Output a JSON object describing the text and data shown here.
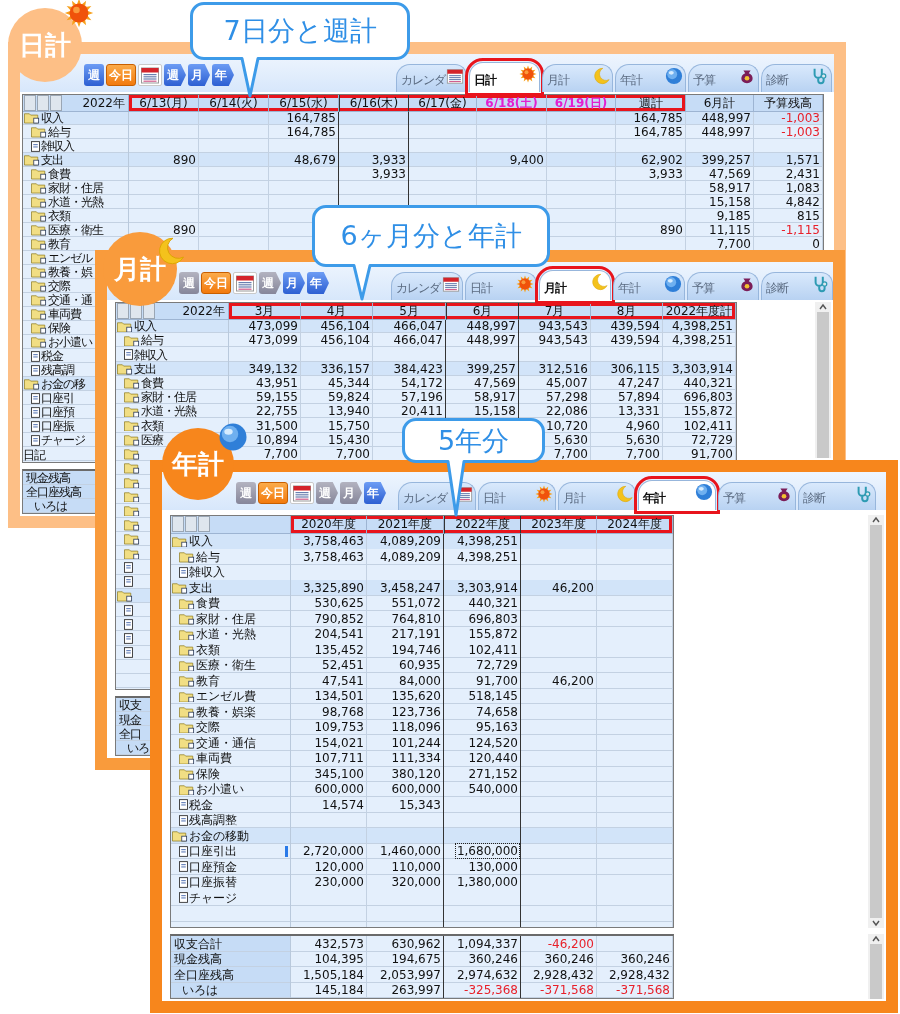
{
  "panels": [
    {
      "kind": "day",
      "badge": "日計",
      "color": "#fdbf86",
      "callout": "7日分と週計",
      "nav": [
        {
          "kind": "prev",
          "label": "週",
          "active": true
        },
        {
          "kind": "today",
          "label": "今日"
        },
        {
          "kind": "calendar"
        },
        {
          "kind": "next",
          "label": "週",
          "active": true
        },
        {
          "kind": "next",
          "label": "月",
          "active": true
        },
        {
          "kind": "next",
          "label": "年",
          "active": true
        }
      ],
      "tabs": [
        {
          "label": "カレンダ",
          "selected": false,
          "highlighted": false
        },
        {
          "label": "日計",
          "selected": true,
          "highlighted": true
        },
        {
          "label": "月計",
          "selected": false,
          "highlighted": false
        },
        {
          "label": "年計",
          "selected": false,
          "highlighted": false
        },
        {
          "label": "予算",
          "selected": false,
          "highlighted": false
        },
        {
          "label": "診断",
          "selected": false,
          "highlighted": false
        }
      ],
      "table": {
        "year_label": "2022年",
        "columns": [
          {
            "label": "6/13(月)",
            "weekend": false,
            "current": false,
            "highlighted": true
          },
          {
            "label": "6/14(火)",
            "weekend": false,
            "current": false,
            "highlighted": true
          },
          {
            "label": "6/15(水)",
            "weekend": false,
            "current": false,
            "highlighted": true
          },
          {
            "label": "6/16(木)",
            "weekend": false,
            "current": true,
            "highlighted": true
          },
          {
            "label": "6/17(金)",
            "weekend": false,
            "current": false,
            "highlighted": true
          },
          {
            "label": "6/18(土)",
            "weekend": true,
            "current": false,
            "highlighted": true
          },
          {
            "label": "6/19(日)",
            "weekend": true,
            "current": false,
            "highlighted": true
          },
          {
            "label": "週計",
            "weekend": false,
            "current": false,
            "highlighted": true
          },
          {
            "label": "6月計",
            "weekend": false,
            "current": false,
            "highlighted": false
          },
          {
            "label": "予算残高",
            "weekend": false,
            "current": false,
            "highlighted": false
          }
        ],
        "rows": [
          {
            "label": "収入",
            "kind": "folder",
            "values": {
              "col_3": "164,785",
              "col_8": "164,785",
              "col_9": "448,997",
              "col_10": {
                "value": "-1,003",
                "negative": true
              }
            },
            "children": [
              {
                "label": "給与",
                "kind": "folder",
                "values": {
                  "col_3": "164,785",
                  "col_8": "164,785",
                  "col_9": "448,997",
                  "col_10": {
                    "value": "-1,003",
                    "negative": true
                  }
                }
              },
              {
                "label": "雑収入",
                "kind": "document"
              }
            ]
          },
          {
            "label": "支出",
            "kind": "folder",
            "values": {
              "col_1": "890",
              "col_3": "48,679",
              "col_4": "3,933",
              "col_6": "9,400",
              "col_8": "62,902",
              "col_9": "399,257",
              "col_10": "1,571"
            },
            "children": [
              {
                "label": "食費",
                "kind": "folder",
                "values": {
                  "col_4": "3,933",
                  "col_8": "3,933",
                  "col_9": "47,569",
                  "col_10": "2,431"
                }
              },
              {
                "label": "家財・住居",
                "kind": "folder",
                "values": {
                  "col_9": "58,917",
                  "col_10": "1,083"
                }
              },
              {
                "label": "水道・光熱",
                "kind": "folder",
                "values": {
                  "col_9": "15,158",
                  "col_10": "4,842"
                }
              },
              {
                "label": "衣類",
                "kind": "folder",
                "values": {
                  "col_9": "9,185",
                  "col_10": "815"
                }
              },
              {
                "label": "医療・衛生",
                "kind": "folder",
                "values": {
                  "col_1": "890",
                  "col_8": "890",
                  "col_9": "11,115",
                  "col_10": {
                    "value": "-1,115",
                    "negative": true
                  }
                }
              },
              {
                "label": "教育",
                "kind": "folder",
                "values": {
                  "col_9": "7,700",
                  "col_10": "0"
                }
              },
              {
                "label": "エンゼル",
                "kind": "folder"
              },
              {
                "label": "教養・娯",
                "kind": "folder"
              },
              {
                "label": "交際",
                "kind": "folder"
              },
              {
                "label": "交通・通",
                "kind": "folder"
              },
              {
                "label": "車両費",
                "kind": "folder"
              },
              {
                "label": "保険",
                "kind": "folder"
              },
              {
                "label": "お小遣い",
                "kind": "folder"
              },
              {
                "label": "税金",
                "kind": "document"
              },
              {
                "label": "残高調",
                "kind": "document"
              }
            ]
          },
          {
            "label": "お金の移",
            "kind": "folder",
            "children": [
              {
                "label": "口座引",
                "kind": "document"
              },
              {
                "label": "口座預",
                "kind": "document"
              },
              {
                "label": "口座振",
                "kind": "document"
              },
              {
                "label": "チャージ",
                "kind": "document"
              }
            ]
          }
        ],
        "diary": "日記",
        "footer": [
          {
            "label": "現金残高"
          },
          {
            "label": "全口座残高",
            "children": [
              {
                "label": "いろは"
              }
            ]
          }
        ]
      }
    },
    {
      "kind": "month",
      "badge": "月計",
      "color": "#f99b3c",
      "callout": "6ヶ月分と年計",
      "nav": [
        {
          "kind": "prev",
          "label": "週",
          "active": false
        },
        {
          "kind": "today",
          "label": "今日"
        },
        {
          "kind": "calendar"
        },
        {
          "kind": "next",
          "label": "週",
          "active": false
        },
        {
          "kind": "next",
          "label": "月",
          "active": true
        },
        {
          "kind": "next",
          "label": "年",
          "active": true
        }
      ],
      "tabs": [
        {
          "label": "カレンダ",
          "selected": false,
          "highlighted": false
        },
        {
          "label": "日計",
          "selected": false,
          "highlighted": false
        },
        {
          "label": "月計",
          "selected": true,
          "highlighted": true
        },
        {
          "label": "年計",
          "selected": false,
          "highlighted": false
        },
        {
          "label": "予算",
          "selected": false,
          "highlighted": false
        },
        {
          "label": "診断",
          "selected": false,
          "highlighted": false
        }
      ],
      "table": {
        "year_label": "2022年",
        "columns": [
          {
            "label": "3月",
            "current": false,
            "highlighted": true
          },
          {
            "label": "4月",
            "current": false,
            "highlighted": true
          },
          {
            "label": "5月",
            "current": false,
            "highlighted": true
          },
          {
            "label": "6月",
            "current": true,
            "highlighted": true
          },
          {
            "label": "7月",
            "current": false,
            "highlighted": true
          },
          {
            "label": "8月",
            "current": false,
            "highlighted": true
          },
          {
            "label": "2022年度計",
            "current": false,
            "highlighted": true
          }
        ],
        "rows": [
          {
            "label": "収入",
            "kind": "folder",
            "values": {
              "col_1": "473,099",
              "col_2": "456,104",
              "col_3": "466,047",
              "col_4": "448,997",
              "col_5": "943,543",
              "col_6": "439,594",
              "col_7": "4,398,251"
            },
            "children": [
              {
                "label": "給与",
                "kind": "folder",
                "values": {
                  "col_1": "473,099",
                  "col_2": "456,104",
                  "col_3": "466,047",
                  "col_4": "448,997",
                  "col_5": "943,543",
                  "col_6": "439,594",
                  "col_7": "4,398,251"
                }
              },
              {
                "label": "雑収入",
                "kind": "document"
              }
            ]
          },
          {
            "label": "支出",
            "kind": "folder",
            "values": {
              "col_1": "349,132",
              "col_2": "336,157",
              "col_3": "384,423",
              "col_4": "399,257",
              "col_5": "312,516",
              "col_6": "306,115",
              "col_7": "3,303,914"
            },
            "children": [
              {
                "label": "食費",
                "kind": "folder",
                "values": {
                  "col_1": "43,951",
                  "col_2": "45,344",
                  "col_3": "54,172",
                  "col_4": "47,569",
                  "col_5": "45,007",
                  "col_6": "47,247",
                  "col_7": "440,321"
                }
              },
              {
                "label": "家財・住居",
                "kind": "folder",
                "values": {
                  "col_1": "59,155",
                  "col_2": "59,824",
                  "col_3": "57,196",
                  "col_4": "58,917",
                  "col_5": "57,298",
                  "col_6": "57,894",
                  "col_7": "696,803"
                }
              },
              {
                "label": "水道・光熱",
                "kind": "folder",
                "values": {
                  "col_1": "22,755",
                  "col_2": "13,940",
                  "col_3": "20,411",
                  "col_4": "15,158",
                  "col_5": "22,086",
                  "col_6": "13,331",
                  "col_7": "155,872"
                }
              },
              {
                "label": "衣類",
                "kind": "folder",
                "values": {
                  "col_1": "31,500",
                  "col_2": "15,750",
                  "col_5": "10,720",
                  "col_6": "4,960",
                  "col_7": "102,411"
                }
              },
              {
                "label": "医療",
                "kind": "folder",
                "values": {
                  "col_1": "10,894",
                  "col_2": "15,430",
                  "col_5": "5,630",
                  "col_6": "5,630",
                  "col_7": "72,729"
                }
              },
              {
                "kind": "folder",
                "values": {
                  "col_1": "7,700",
                  "col_2": "7,700",
                  "col_5": "7,700",
                  "col_6": "7,700",
                  "col_7": "91,700"
                }
              },
              {
                "kind": "folder"
              },
              {
                "kind": "folder"
              },
              {
                "kind": "folder"
              },
              {
                "kind": "folder"
              },
              {
                "kind": "folder"
              },
              {
                "kind": "folder"
              },
              {
                "kind": "folder"
              },
              {
                "kind": "document"
              },
              {
                "kind": "document"
              }
            ]
          },
          {
            "kind": "folder",
            "children": [
              {
                "kind": "document"
              },
              {
                "kind": "document"
              },
              {
                "kind": "document"
              },
              {
                "kind": "document"
              }
            ]
          }
        ],
        "footer": [
          {
            "label": "収支"
          },
          {
            "label": "現金"
          },
          {
            "label": "全口",
            "children": [
              {
                "label": "いろ"
              }
            ]
          }
        ]
      }
    },
    {
      "kind": "year",
      "badge": "年計",
      "color": "#f7861c",
      "callout": "5年分",
      "nav": [
        {
          "kind": "prev",
          "label": "週",
          "active": false
        },
        {
          "kind": "today",
          "label": "今日"
        },
        {
          "kind": "calendar"
        },
        {
          "kind": "next",
          "label": "週",
          "active": false
        },
        {
          "kind": "next",
          "label": "月",
          "active": false
        },
        {
          "kind": "next",
          "label": "年",
          "active": true
        }
      ],
      "tabs": [
        {
          "label": "カレンダ",
          "selected": false,
          "highlighted": false
        },
        {
          "label": "日計",
          "selected": false,
          "highlighted": false
        },
        {
          "label": "月計",
          "selected": false,
          "highlighted": false
        },
        {
          "label": "年計",
          "selected": true,
          "highlighted": true
        },
        {
          "label": "予算",
          "selected": false,
          "highlighted": false
        },
        {
          "label": "診断",
          "selected": false,
          "highlighted": false
        }
      ],
      "table": {
        "columns": [
          {
            "label": "2020年度",
            "current": false,
            "highlighted": true
          },
          {
            "label": "2021年度",
            "current": false,
            "highlighted": true
          },
          {
            "label": "2022年度",
            "current": true,
            "highlighted": true
          },
          {
            "label": "2023年度",
            "current": false,
            "highlighted": true
          },
          {
            "label": "2024年度",
            "current": false,
            "highlighted": true
          }
        ],
        "rows": [
          {
            "label": "収入",
            "kind": "folder",
            "values": {
              "col_1": "3,758,463",
              "col_2": "4,089,209",
              "col_3": "4,398,251"
            },
            "children": [
              {
                "label": "給与",
                "kind": "folder",
                "values": {
                  "col_1": "3,758,463",
                  "col_2": "4,089,209",
                  "col_3": "4,398,251"
                }
              },
              {
                "label": "雑収入",
                "kind": "document"
              }
            ]
          },
          {
            "label": "支出",
            "kind": "folder",
            "values": {
              "col_1": "3,325,890",
              "col_2": "3,458,247",
              "col_3": "3,303,914",
              "col_4": "46,200"
            },
            "children": [
              {
                "label": "食費",
                "kind": "folder",
                "values": {
                  "col_1": "530,625",
                  "col_2": "551,072",
                  "col_3": "440,321"
                }
              },
              {
                "label": "家財・住居",
                "kind": "folder",
                "values": {
                  "col_1": "790,852",
                  "col_2": "764,810",
                  "col_3": "696,803"
                }
              },
              {
                "label": "水道・光熱",
                "kind": "folder",
                "values": {
                  "col_1": "204,541",
                  "col_2": "217,191",
                  "col_3": "155,872"
                }
              },
              {
                "label": "衣類",
                "kind": "folder",
                "values": {
                  "col_1": "135,452",
                  "col_2": "194,746",
                  "col_3": "102,411"
                }
              },
              {
                "label": "医療・衛生",
                "kind": "folder",
                "values": {
                  "col_1": "52,451",
                  "col_2": "60,935",
                  "col_3": "72,729"
                }
              },
              {
                "label": "教育",
                "kind": "folder",
                "values": {
                  "col_1": "47,541",
                  "col_2": "84,000",
                  "col_3": "91,700",
                  "col_4": "46,200"
                }
              },
              {
                "label": "エンゼル費",
                "kind": "folder",
                "values": {
                  "col_1": "134,501",
                  "col_2": "135,620",
                  "col_3": "518,145"
                }
              },
              {
                "label": "教養・娯楽",
                "kind": "folder",
                "values": {
                  "col_1": "98,768",
                  "col_2": "123,736",
                  "col_3": "74,658"
                }
              },
              {
                "label": "交際",
                "kind": "folder",
                "values": {
                  "col_1": "109,753",
                  "col_2": "118,096",
                  "col_3": "95,163"
                }
              },
              {
                "label": "交通・通信",
                "kind": "folder",
                "values": {
                  "col_1": "154,021",
                  "col_2": "101,244",
                  "col_3": "124,520"
                }
              },
              {
                "label": "車両費",
                "kind": "folder",
                "values": {
                  "col_1": "107,711",
                  "col_2": "111,334",
                  "col_3": "120,440"
                }
              },
              {
                "label": "保険",
                "kind": "folder",
                "values": {
                  "col_1": "345,100",
                  "col_2": "380,120",
                  "col_3": "271,152"
                }
              },
              {
                "label": "お小遣い",
                "kind": "folder",
                "values": {
                  "col_1": "600,000",
                  "col_2": "600,000",
                  "col_3": "540,000"
                }
              },
              {
                "label": "税金",
                "kind": "document",
                "values": {
                  "col_1": "14,574",
                  "col_2": "15,343"
                }
              },
              {
                "label": "残高調整",
                "kind": "document"
              }
            ]
          },
          {
            "label": "お金の移動",
            "kind": "folder",
            "children": [
              {
                "label": "口座引出",
                "kind": "document",
                "values": {
                  "col_1": "2,720,000",
                  "col_2": "1,460,000",
                  "col_3": {
                    "value": "1,680,000",
                    "selected": true
                  }
                }
              },
              {
                "label": "口座預金",
                "kind": "document",
                "values": {
                  "col_1": "120,000",
                  "col_2": "110,000",
                  "col_3": "130,000"
                }
              },
              {
                "label": "口座振替",
                "kind": "document",
                "values": {
                  "col_1": "230,000",
                  "col_2": "320,000",
                  "col_3": "1,380,000"
                }
              },
              {
                "label": "チャージ",
                "kind": "document"
              }
            ]
          }
        ],
        "footer": [
          {
            "label": "収支合計",
            "values": {
              "col_1": "432,573",
              "col_2": "630,962",
              "col_3": "1,094,337",
              "col_4": {
                "value": "-46,200",
                "negative": true
              }
            }
          },
          {
            "label": "現金残高",
            "values": {
              "col_1": "104,395",
              "col_2": "194,675",
              "col_3": "360,246",
              "col_4": "360,246",
              "col_5": "360,246"
            }
          },
          {
            "label": "全口座残高",
            "values": {
              "col_1": "1,505,184",
              "col_2": "2,053,997",
              "col_3": "2,974,632",
              "col_4": "2,928,432",
              "col_5": "2,928,432"
            },
            "children": [
              {
                "label": "いろは",
                "values": {
                  "col_1": "145,184",
                  "col_2": "263,997",
                  "col_3": {
                    "value": "-325,368",
                    "negative": true
                  },
                  "col_4": {
                    "value": "-371,568",
                    "negative": true
                  },
                  "col_5": {
                    "value": "-371,568",
                    "negative": true
                  }
                }
              }
            ]
          }
        ]
      }
    }
  ]
}
